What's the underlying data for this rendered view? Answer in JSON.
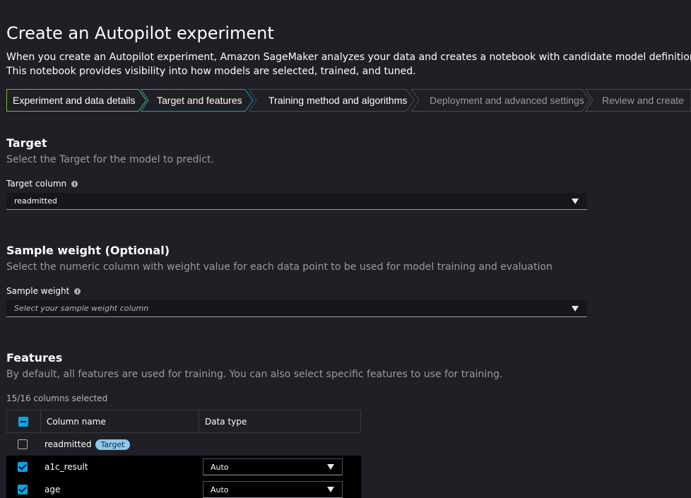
{
  "header": {
    "title": "Create an Autopilot experiment",
    "description_line1": "When you create an Autopilot experiment, Amazon SageMaker analyzes your data and creates a notebook with candidate model definitions.",
    "description_line2": "This notebook provides visibility into how models are selected, trained, and tuned."
  },
  "steps": [
    {
      "label": "Experiment and data details",
      "state": "completed"
    },
    {
      "label": "Target and features",
      "state": "active"
    },
    {
      "label": "Training method and algorithms",
      "state": "upcoming"
    },
    {
      "label": "Deployment and advanced settings",
      "state": "disabled"
    },
    {
      "label": "Review and create",
      "state": "disabled"
    }
  ],
  "target": {
    "heading": "Target",
    "subtitle": "Select the Target for the model to predict.",
    "field_label": "Target column",
    "selected_value": "readmitted"
  },
  "sample_weight": {
    "heading": "Sample weight (Optional)",
    "subtitle": "Select the numeric column with weight value for each data point to be used for model training and evaluation",
    "field_label": "Sample weight",
    "placeholder": "Select your sample weight column"
  },
  "features": {
    "heading": "Features",
    "subtitle": "By default, all features are used for training. You can also select specific features to use for training.",
    "selection_count": "15/16 columns selected",
    "columns": [
      "Column name",
      "Data type"
    ],
    "rows": [
      {
        "name": "readmitted",
        "badge": "Target",
        "checked": false
      },
      {
        "name": "a1c_result",
        "data_type": "Auto",
        "checked": true
      },
      {
        "name": "age",
        "data_type": "Auto",
        "checked": true
      }
    ]
  },
  "colors": {
    "background": "#1f1f25",
    "completed_step_border": "#6fb83f",
    "active_step_border": "#1a9ad6",
    "checkbox_accent": "#0aa5e6",
    "badge_bg": "#8cc8f0"
  }
}
